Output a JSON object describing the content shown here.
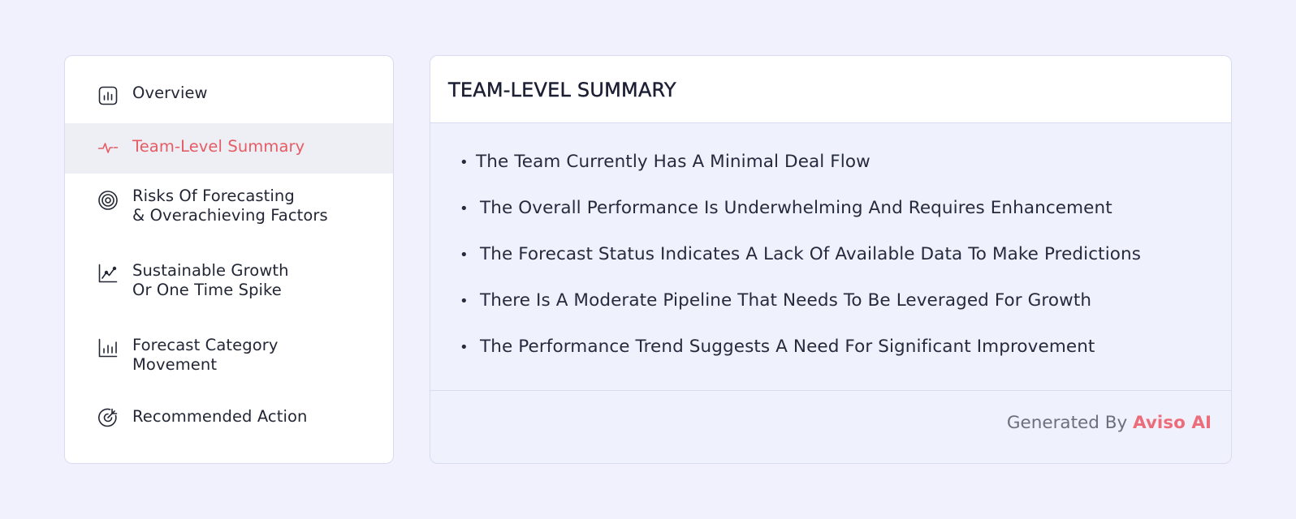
{
  "sidebar": {
    "items": [
      {
        "icon": "bar-chart-icon",
        "line1": "Overview",
        "line2": "",
        "active": false
      },
      {
        "icon": "pulse-icon",
        "line1": "Team-Level Summary",
        "line2": "",
        "active": true
      },
      {
        "icon": "target-icon",
        "line1": "Risks Of Forecasting",
        "line2": "& Overachieving Factors",
        "active": false
      },
      {
        "icon": "line-chart-icon",
        "line1": "Sustainable Growth",
        "line2": "Or One Time Spike",
        "active": false
      },
      {
        "icon": "bar-growth-icon",
        "line1": "Forecast Category",
        "line2": "Movement",
        "active": false
      },
      {
        "icon": "target-arrow-icon",
        "line1": "Recommended Action",
        "line2": "",
        "active": false
      }
    ]
  },
  "panel": {
    "title": "TEAM-LEVEL SUMMARY",
    "bullets": [
      "The Team Currently Has A Minimal Deal Flow",
      "The Overall Performance Is Underwhelming And Requires Enhancement",
      "The Forecast Status Indicates A Lack Of Available Data To Make Predictions",
      "There Is A Moderate Pipeline That Needs To Be Leveraged For Growth",
      "The Performance Trend Suggests A Need For Significant Improvement"
    ],
    "bullet_marker": "•",
    "footer": {
      "prefix": "Generated By",
      "brand": "Aviso AI"
    }
  },
  "colors": {
    "accent": "#e55c64",
    "brand": "#ec6d7a",
    "background": "#f0f1fc",
    "border": "#d9dbf1"
  }
}
